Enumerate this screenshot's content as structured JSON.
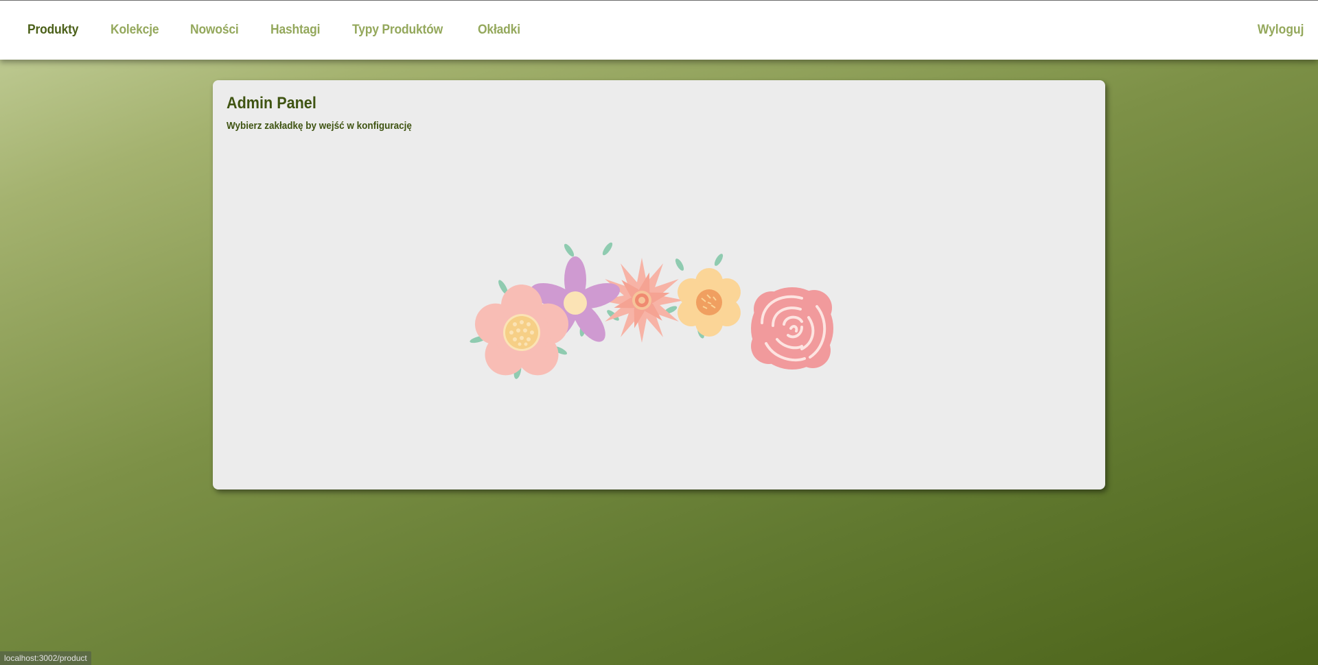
{
  "nav": {
    "items": [
      {
        "label": "Produkty",
        "active": true
      },
      {
        "label": "Kolekcje",
        "active": false
      },
      {
        "label": "Nowości",
        "active": false
      },
      {
        "label": "Hashtagi",
        "active": false
      },
      {
        "label": "Typy Produktów",
        "active": false
      },
      {
        "label": "Okładki",
        "active": false
      }
    ],
    "logout_label": "Wyloguj"
  },
  "panel": {
    "title": "Admin Panel",
    "subtitle": "Wybierz zakładkę by wejść w konfigurację",
    "illustration": "flowers-illustration"
  },
  "statusbar": {
    "url": "localhost:3002/product"
  },
  "colors": {
    "nav_active": "#4b6019",
    "nav_inactive": "#94a85c",
    "panel_bg": "#ececec",
    "background_start": "#c6d19d",
    "background_end": "#4b6319"
  }
}
